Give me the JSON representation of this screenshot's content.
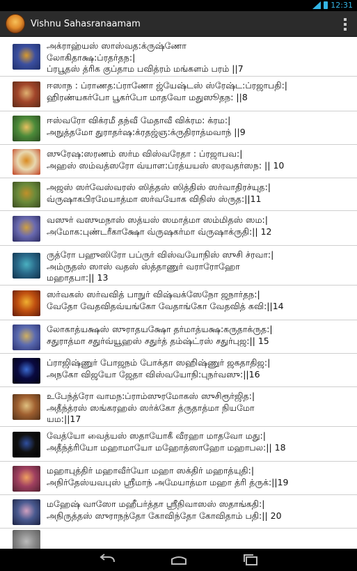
{
  "status_bar": {
    "time": "12:31",
    "signal": "3G"
  },
  "app": {
    "title": "Vishnu Sahasranaamam"
  },
  "verses": [
    {
      "text": "அக்ராஹ்யஸ் ஸாஸ்வத:க்ருஷ்ணோ\nலோகிதாக்ஷ:ப்ரதர்தந:|\nப்ரபூதஸ் த்ரிக குப்தாம பவித்ரம் மங்களம் பரம் ||7",
      "colors": [
        "#3b4fa0",
        "#d99a2c",
        "#1f2f6a"
      ]
    },
    {
      "text": "ஈஸாந : ப்ராணத:ப்ராணோ ஜ்யேஷ்டஸ் ஸ்ரேஷ்ட:ப்ரஜாபதி:|\nஹிரண்யகர்போ பூகர்போ மாதவோ மதுஸூதந: ||8",
      "colors": [
        "#a1452a",
        "#e0b070",
        "#5a2a18"
      ]
    },
    {
      "text": "ஈஸ்வரோ விக்ரமீ தந்வீ மேதாவீ விக்ரம: க்ரம:|\nஅநுத்தமோ துராதர்ஷ:க்ரதஜ்ஞ:க்ருதிராத்மவாந் ||9",
      "colors": [
        "#4c8b3a",
        "#e8c060",
        "#2a4a20"
      ]
    },
    {
      "text": "ஸுரேஷ:ஸரணம் ஸர்ம விஸ்வரேதா : ப்ரஜாபவ:|\nஅஹஸ் ஸம்வத்ஸரோ வ்யாள:ப்ரத்யயஸ் ஸரவதர்ஸந: || 10",
      "colors": [
        "#e8d8b0",
        "#d98a20",
        "#c04020"
      ]
    },
    {
      "text": "அஜஸ் ஸர்வேஸ்வரஸ் ஸித்தஸ் ஸித்திஸ் ஸர்வாதிரச்யுத:|\nவ்ருஷாகபிரமேயாத்மா ஸர்வயோக விநிஸ் ஸ்ருத:||11",
      "colors": [
        "#6a8a3a",
        "#c0902a",
        "#3a4a20"
      ]
    },
    {
      "text": "வஸுர் வஸுமநாஸ் ஸத்யஸ் ஸமாத்மா ஸம்மிதஸ் ஸம:|\nஅமோக:புண்டரீகாக்ஷோ வ்ருஷகர்மா வ்ருஷாக்ருதி:|| 12",
      "colors": [
        "#6a6ab0",
        "#d0a040",
        "#2a2a60"
      ]
    },
    {
      "text": "ருத்ரோ பஹுஸிரோ பப்ருர் விஸ்வயோநிஸ் ஸுசி ச்ரவா:|\nஅம்ருதஸ் ஸாஸ் வதஸ் ஸ்த்தாணுர் வராரோஹோ\nமஹாதபா:|| 13",
      "colors": [
        "#2a6a8a",
        "#4ab0c0",
        "#10304a"
      ]
    },
    {
      "text": "ஸர்வகஸ் ஸர்வவித் பாநுர் விஷ்வக்ஸேநோ ஜநார்தந:|\nவேதோ வேதவிதவ்யங்கோ வேதாங்கோ வேதவித் கவி:||14",
      "colors": [
        "#c05010",
        "#f0b030",
        "#601a08"
      ]
    },
    {
      "text": "லோகாத்யக்ஷஸ் ஸுராதயக்ஷோ தர்மாத்யக்ஷ:கருதாக்ருத:|\nசதுராத்மா சதுர்வ்யூஹஸ் சதுர்த் தம்ஷ்ட்ரஸ் சதுர்புஜ:|| 15",
      "colors": [
        "#5a6ab0",
        "#d0b060",
        "#2a3070"
      ]
    },
    {
      "text": "ப்ராஜிஷ்ணுர் போஜநம் போக்தா ஸஹிஷ்ணுர் ஜகதாதிஜ:|\nஅநகோ விஜயோ ஜேதா விஸ்வயோநி:புநர்வஸு:||16",
      "colors": [
        "#0a0a40",
        "#3a6ad0",
        "#000010"
      ]
    },
    {
      "text": "உபேந்த்ரோ வாமந:ப்ராம்ஸுரமோகஸ் ஸுசிரூர்ஜித:|\nஅதீந்த்ரஸ் ஸங்கரஹஸ் ஸர்க்கோ த்ருதாத்மா நியமோ\nயம:||17",
      "colors": [
        "#a06030",
        "#e0c080",
        "#503018"
      ]
    },
    {
      "text": "வேத்யோ வைத்யஸ் ஸதாயோகீ வீரஹா மாதவோ மது:|\nஅதீந்த்ரியோ மஹாமாயோ மஹோத்ஸாஹோ மஹாபல:|| 18",
      "colors": [
        "#101010",
        "#3050a0",
        "#000000"
      ]
    },
    {
      "text": "மஹாபுத்திர் மஹாவீர்யோ மஹா ஸக்திர் மஹாத்யுதி:|\nஅநிர்தேஸ்யவபுஸ் ஸ்ரீமாந் அமேயாத்மா மஹா த்ரி த்ருக்:||19",
      "colors": [
        "#a04060",
        "#f0a060",
        "#502030"
      ]
    },
    {
      "text": "மஹேஷ் வாஸோ மஹீபர்த்தா ஸ்ரீநிவாஸஸ் ஸதாங்கதி:|\nஅநிருத்தஸ் ஸுராநந்தோ கோவிந்தோ கோவிதாம் பதி:|| 20",
      "colors": [
        "#4a5a90",
        "#d0a0c0",
        "#1a2040"
      ]
    },
    {
      "text": "",
      "colors": [
        "#888888",
        "#bbbbbb",
        "#555555"
      ]
    }
  ],
  "icons": {
    "app": "app-deity-icon",
    "menu": "overflow-menu-icon",
    "back": "back-icon",
    "home": "home-icon",
    "recents": "recent-apps-icon"
  }
}
